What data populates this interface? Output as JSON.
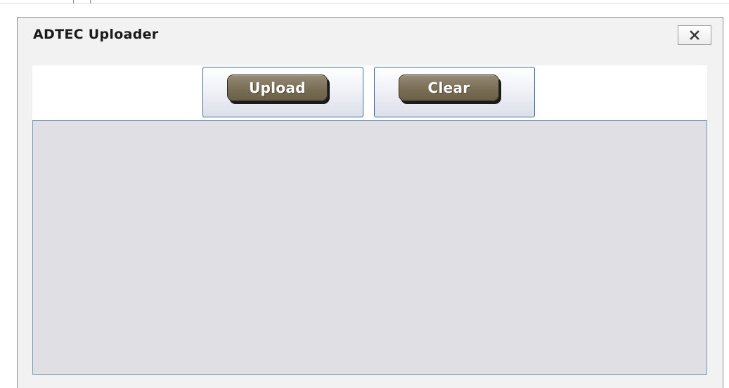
{
  "dialog": {
    "title": "ADTEC Uploader",
    "close_icon": "close-icon"
  },
  "toolbar": {
    "upload_label": "Upload",
    "clear_label": "Clear"
  },
  "colors": {
    "button_fill": "#7a6e55",
    "dropzone_fill": "#e0dfe4",
    "frame_border": "#3f6e9e"
  }
}
